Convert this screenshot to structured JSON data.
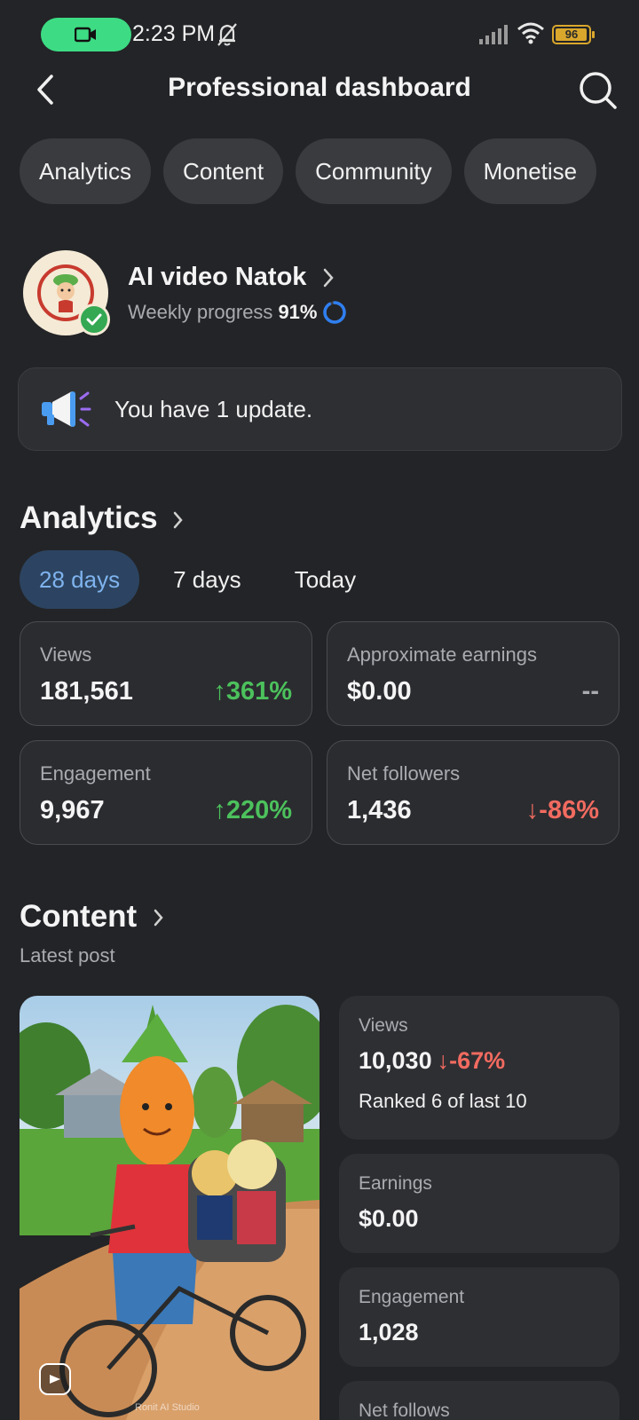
{
  "status_bar": {
    "time": "2:23 PM",
    "battery": "96",
    "battery_level": 0.96
  },
  "header": {
    "title": "Professional dashboard"
  },
  "tabs": [
    "Analytics",
    "Content",
    "Community",
    "Monetise"
  ],
  "profile": {
    "name": "AI video Natok",
    "progress_label": "Weekly progress",
    "progress_value": "91%",
    "progress_fraction": 0.91
  },
  "update": {
    "text": "You have 1 update."
  },
  "analytics": {
    "title": "Analytics",
    "ranges": [
      "28 days",
      "7 days",
      "Today"
    ],
    "active_range": "28 days",
    "cards": [
      {
        "label": "Views",
        "value": "181,561",
        "change": "361%",
        "trend": "up"
      },
      {
        "label": "Approximate earnings",
        "value": "$0.00",
        "change": "--",
        "trend": "none"
      },
      {
        "label": "Engagement",
        "value": "9,967",
        "change": "220%",
        "trend": "up"
      },
      {
        "label": "Net followers",
        "value": "1,436",
        "change": "-86%",
        "trend": "down"
      }
    ]
  },
  "content": {
    "title": "Content",
    "subtitle": "Latest post",
    "stats": {
      "views": {
        "label": "Views",
        "value": "10,030",
        "change": "-67%",
        "rank": "Ranked 6 of last 10"
      },
      "earnings": {
        "label": "Earnings",
        "value": "$0.00"
      },
      "engagement": {
        "label": "Engagement",
        "value": "1,028"
      },
      "follows": {
        "label": "Net follows"
      }
    },
    "watermark": "Ronit AI Studio"
  },
  "colors": {
    "background": "#232427",
    "card": "#2b2c30",
    "up": "#4cc15c",
    "down": "#f26b60",
    "accent": "#7fb3ee"
  }
}
